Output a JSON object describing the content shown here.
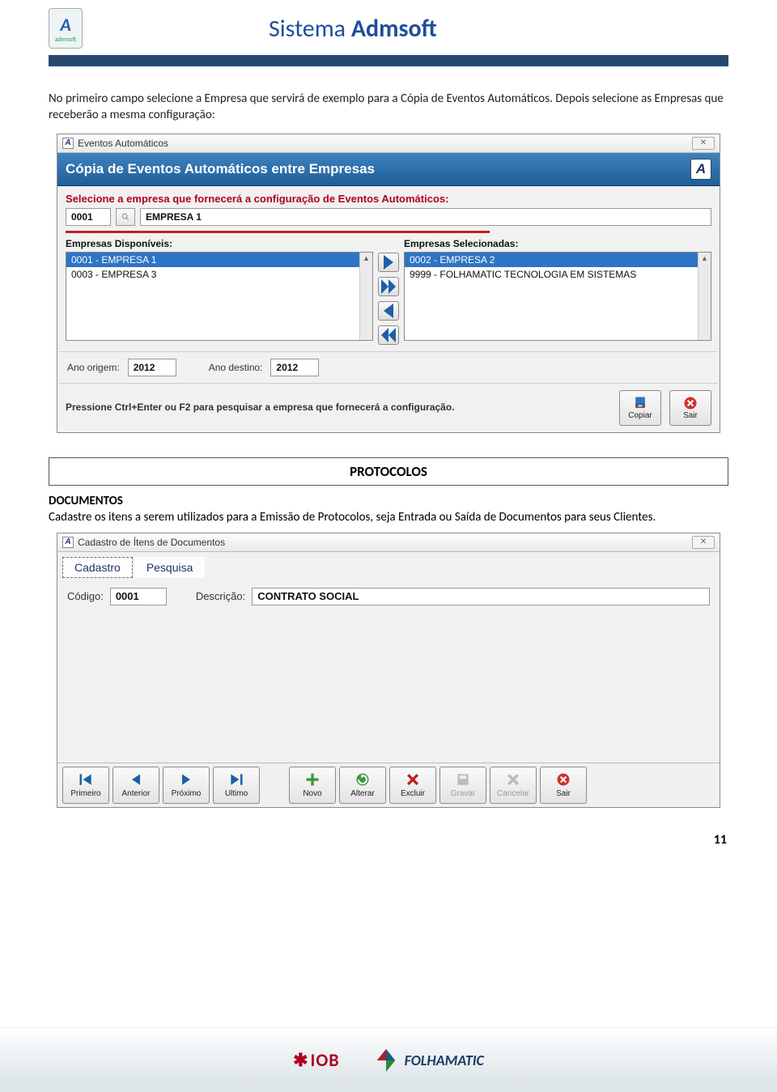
{
  "header": {
    "logo_letter": "A",
    "logo_sub": "admsoft",
    "title_pre": "Sistema ",
    "title_bold": "Admsoft"
  },
  "intro": "No primeiro campo selecione a Empresa que servirá de exemplo para a Cópia de Eventos Automáticos. Depois selecione as Empresas que receberão a mesma configuração:",
  "win1": {
    "title": "Eventos Automáticos",
    "subtitle": "Cópia de Eventos Automáticos entre Empresas",
    "instruction": "Selecione a empresa que fornecerá a configuração de Eventos Automáticos:",
    "codigo": "0001",
    "empresa": "EMPRESA 1",
    "label_disp": "Empresas Disponíveis:",
    "label_sel": "Empresas Selecionadas:",
    "disponiveis": [
      "0001 - EMPRESA 1",
      "0003 - EMPRESA 3"
    ],
    "selecionadas": [
      "0002 - EMPRESA 2",
      "9999 - FOLHAMATIC TECNOLOGIA EM SISTEMAS"
    ],
    "ano_origem_label": "Ano origem:",
    "ano_origem": "2012",
    "ano_destino_label": "Ano destino:",
    "ano_destino": "2012",
    "hint": "Pressione Ctrl+Enter ou F2 para pesquisar a empresa que fornecerá a configuração.",
    "btn_copiar": "Copiar",
    "btn_sair": "Sair"
  },
  "banner": "PROTOCOLOS",
  "sect": {
    "heading": "DOCUMENTOS",
    "text": "Cadastre os itens a serem utilizados para a Emissão de Protocolos, seja Entrada ou Saída de Documentos para seus Clientes."
  },
  "win2": {
    "title": "Cadastro de Ítens de Documentos",
    "tab1": "Cadastro",
    "tab2": "Pesquisa",
    "codigo_label": "Código:",
    "codigo": "0001",
    "desc_label": "Descrição:",
    "desc": "CONTRATO SOCIAL",
    "buttons": {
      "primeiro": "Primeiro",
      "anterior": "Anterior",
      "proximo": "Próximo",
      "ultimo": "Ultimo",
      "novo": "Novo",
      "alterar": "Alterar",
      "excluir": "Excluir",
      "gravar": "Gravar",
      "cancelar": "Cancelar",
      "sair": "Sair"
    }
  },
  "footer": {
    "iob": "IOB",
    "folha": "FOLHAMATIC"
  },
  "page_number": "11"
}
